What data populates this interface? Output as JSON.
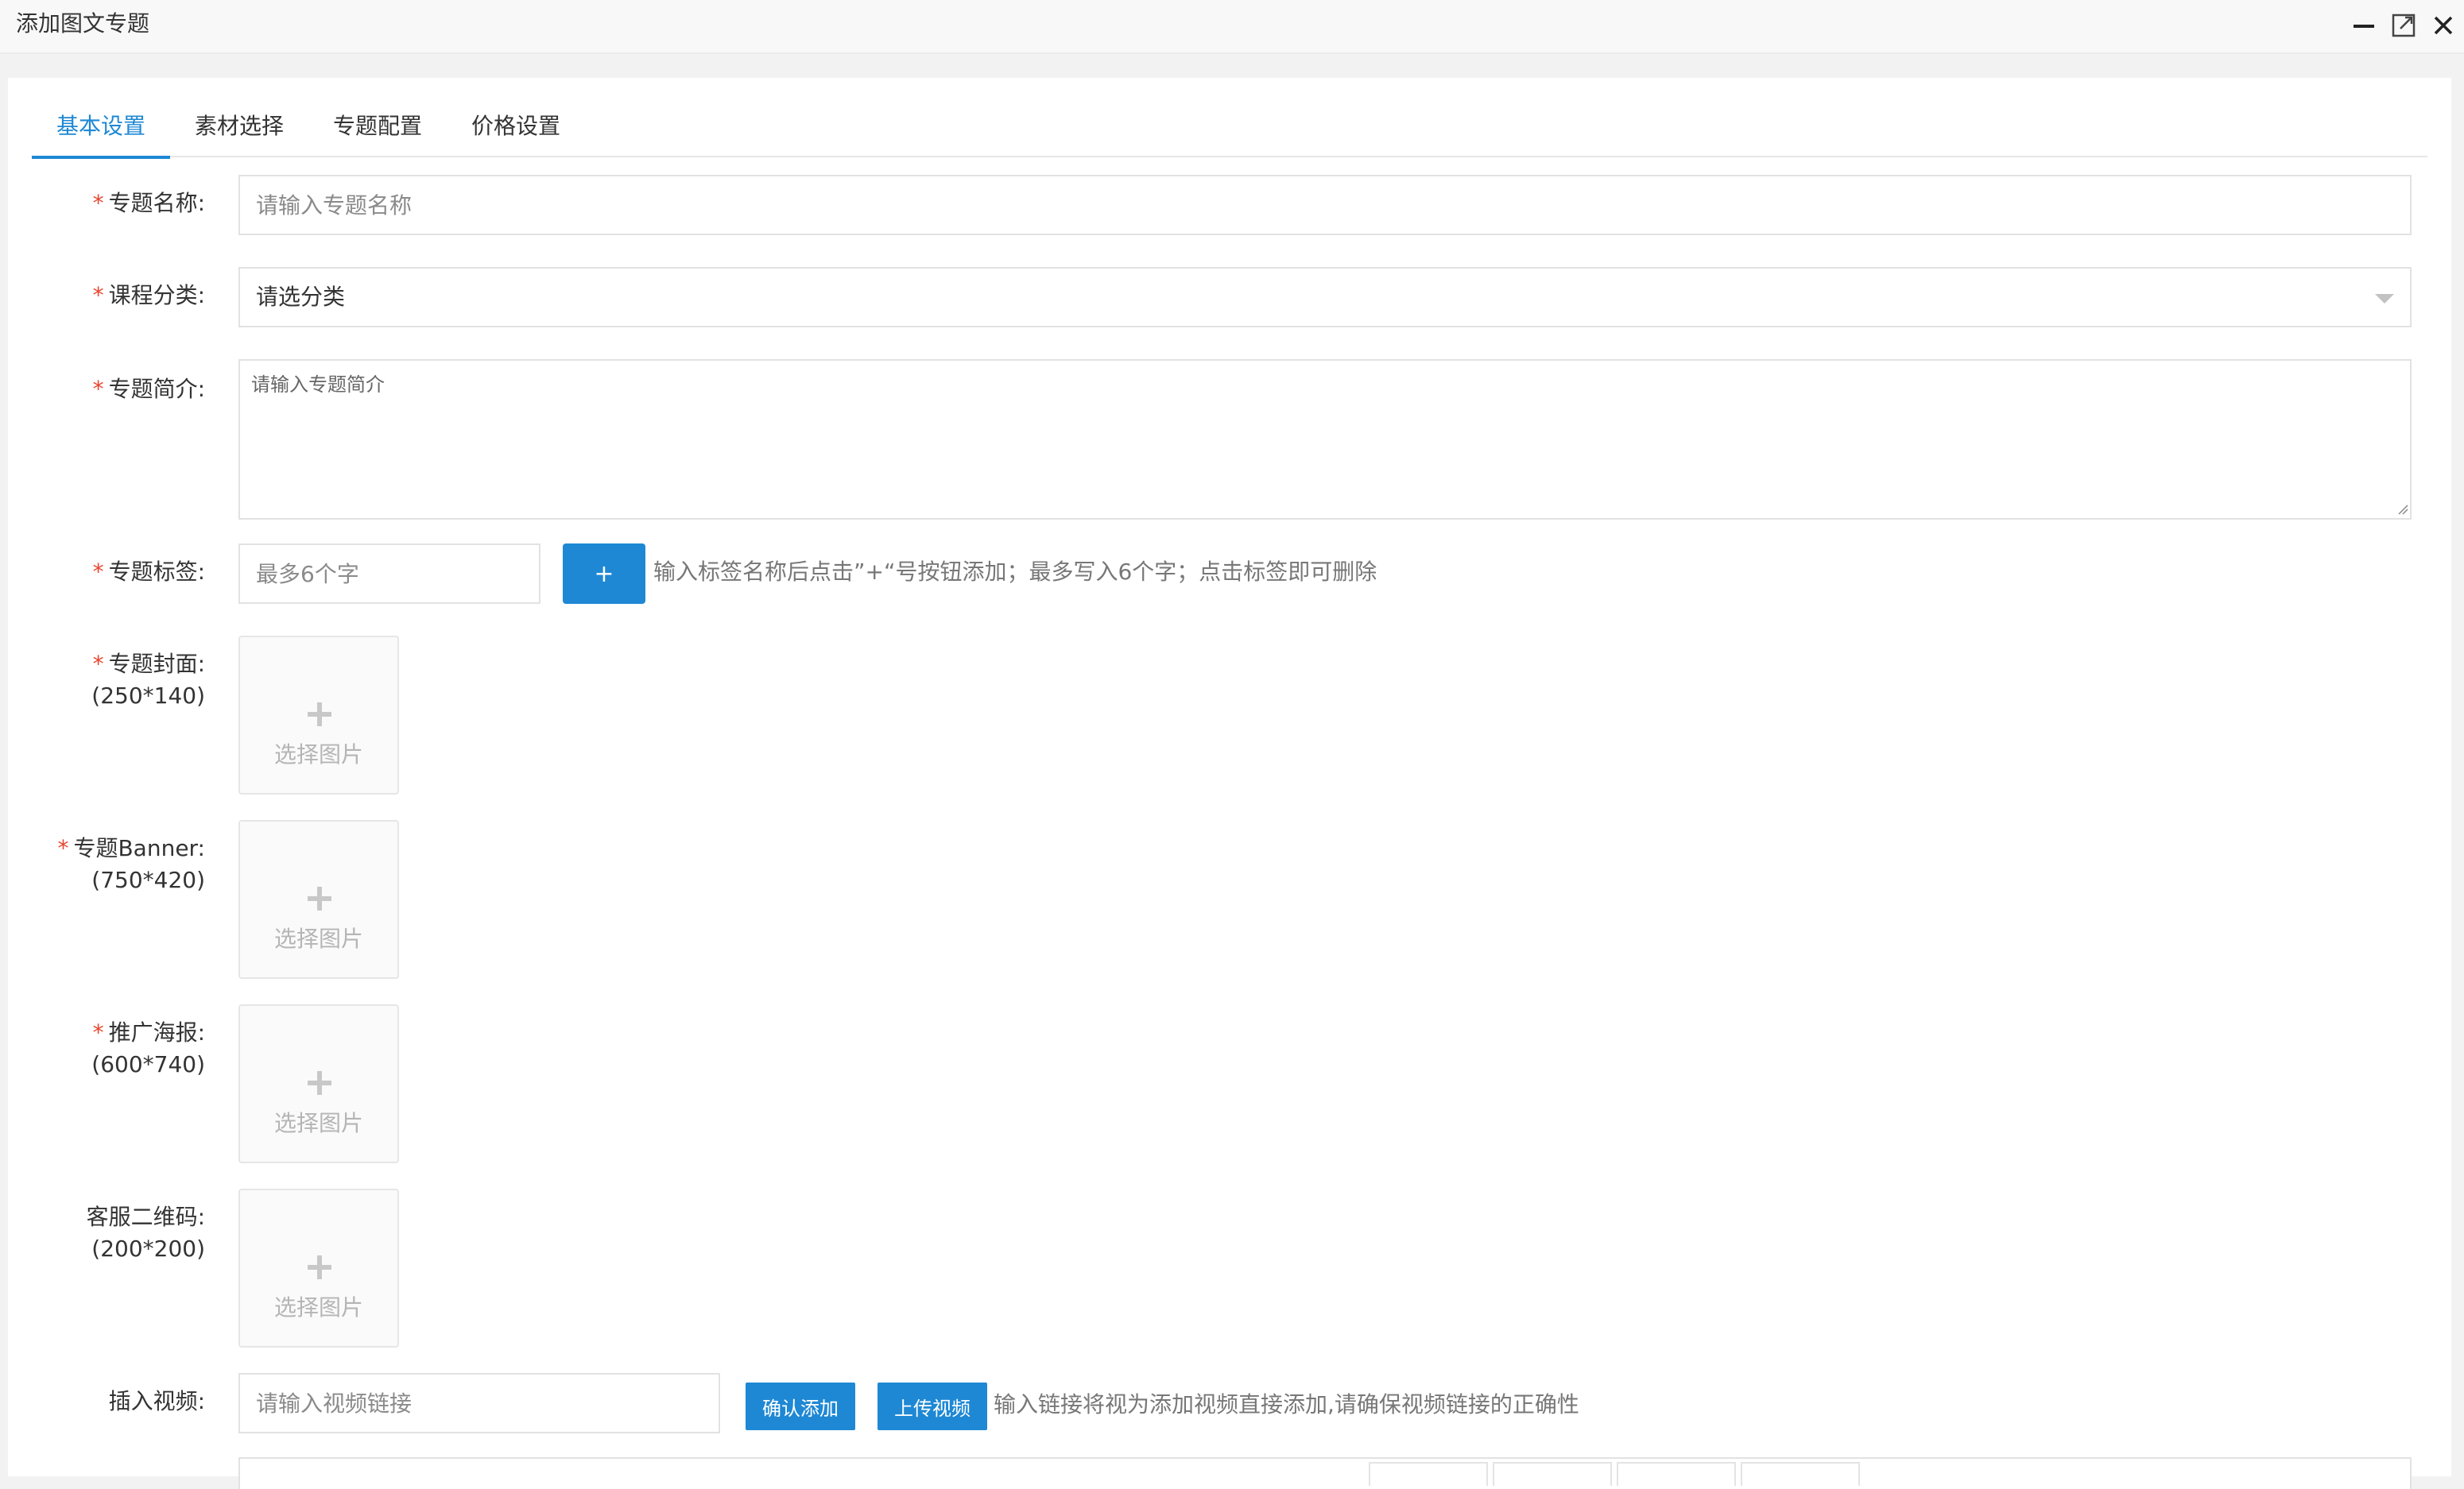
{
  "window": {
    "title": "添加图文专题",
    "icons": [
      "minimize-icon",
      "maximize-icon",
      "close-icon"
    ]
  },
  "tabs": [
    {
      "label": "基本设置",
      "active": true
    },
    {
      "label": "素材选择",
      "active": false
    },
    {
      "label": "专题配置",
      "active": false
    },
    {
      "label": "价格设置",
      "active": false
    }
  ],
  "form": {
    "required_mark": "*",
    "name": {
      "label": "专题名称:",
      "placeholder": "请输入专题名称"
    },
    "category": {
      "label": "课程分类:",
      "value": "请选分类"
    },
    "intro": {
      "label": "专题简介:",
      "placeholder": "请输入专题简介"
    },
    "tags": {
      "label": "专题标签:",
      "placeholder": "最多6个字",
      "add_button": "+",
      "hint": "输入标签名称后点击”+“号按钮添加；最多写入6个字；点击标签即可删除"
    },
    "cover": {
      "label": "专题封面:",
      "size": "(250*140)",
      "upload_text": "选择图片"
    },
    "banner": {
      "label": "专题Banner:",
      "size": "(750*420)",
      "upload_text": "选择图片"
    },
    "poster": {
      "label": "推广海报:",
      "size": "(600*740)",
      "upload_text": "选择图片"
    },
    "qrcode": {
      "label": "客服二维码:",
      "size": "(200*200)",
      "upload_text": "选择图片"
    },
    "video": {
      "label": "插入视频:",
      "placeholder": "请输入视频链接",
      "confirm_button": "确认添加",
      "upload_button": "上传视频",
      "hint": "输入链接将视为添加视频直接添加,请确保视频链接的正确性"
    }
  },
  "colors": {
    "accent": "#1e88d4",
    "required": "#e8452f",
    "border": "#e2e2e2"
  }
}
